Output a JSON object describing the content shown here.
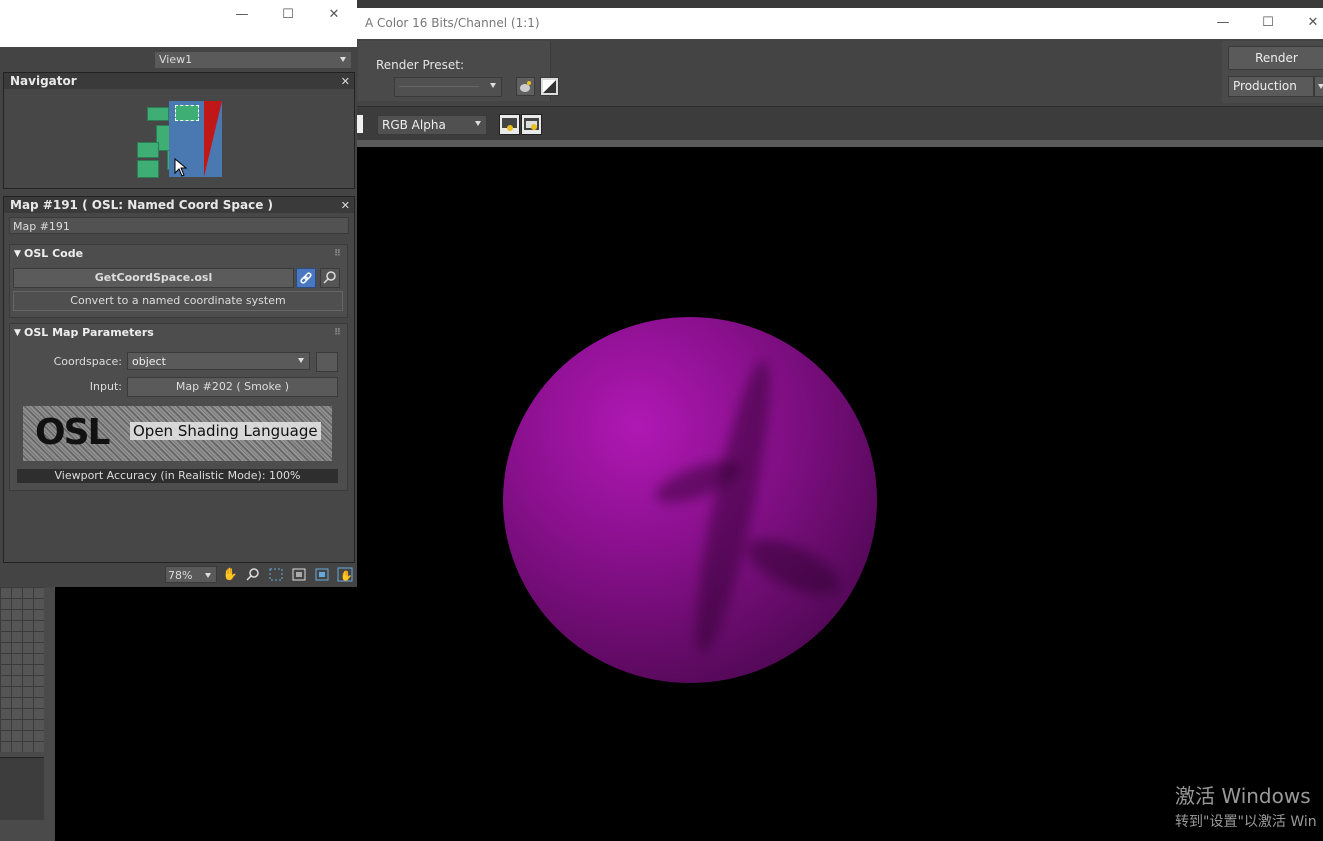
{
  "render_window": {
    "title": "A Color 16 Bits/Channel (1:1)",
    "controls": {
      "minimize": "—",
      "maximize": "☐",
      "close": "✕"
    },
    "render_preset_label": "Render Preset:",
    "render_preset_value": "",
    "render_button": "Render",
    "production_value": "Production",
    "channel_value": "RGB Alpha"
  },
  "material_window": {
    "controls": {
      "minimize": "—",
      "maximize": "☐",
      "close": "✕"
    },
    "view_value": "View1",
    "navigator_title": "Navigator",
    "map_panel_title": "Map #191  ( OSL: Named Coord Space )",
    "map_name": "Map #191",
    "osl_code": {
      "title": "OSL Code",
      "file_button": "GetCoordSpace.osl",
      "description": "Convert to a named coordinate system"
    },
    "osl_params": {
      "title": "OSL Map Parameters",
      "coordspace_label": "Coordspace:",
      "coordspace_value": "object",
      "input_label": "Input:",
      "input_value": "Map #202  ( Smoke )",
      "logo_mark": "OSL",
      "logo_text": "Open Shading Language",
      "accuracy": "Viewport Accuracy (in Realistic Mode): 100%"
    },
    "zoom_value": "78%"
  },
  "watermark": {
    "line1": "激活 Windows",
    "line2": "转到\"设置\"以激活 Win"
  }
}
